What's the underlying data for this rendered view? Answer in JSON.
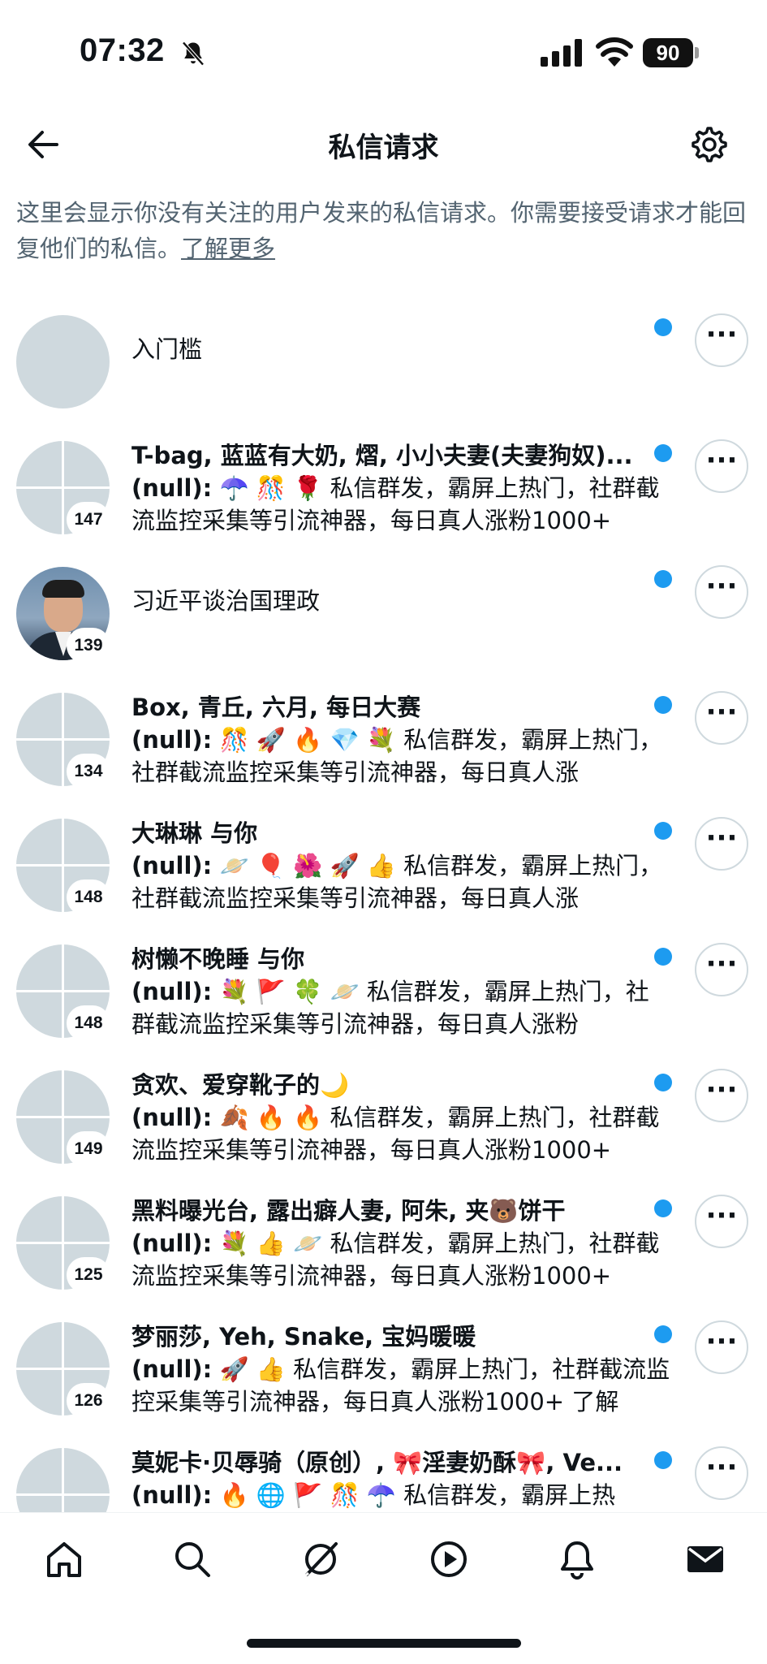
{
  "status_bar": {
    "time": "07:32",
    "battery": "90"
  },
  "header": {
    "title": "私信请求"
  },
  "description": {
    "text": "这里会显示你没有关注的用户发来的私信请求。你需要接受请求才能回复他们的私信。",
    "link": "了解更多"
  },
  "conversations": [
    {
      "name": "入门槛",
      "preview": "",
      "count": ""
    },
    {
      "name": "T-bag, 蓝蓝有大奶, 熠, 小小夫妻(夫妻狗奴)...",
      "preview": "☂️ 🎊 🌹 私信群发，霸屏上热门，社群截流监控采集等引流神器，每日真人涨粉1000+",
      "count": "147"
    },
    {
      "name": "习近平谈治国理政",
      "preview": "",
      "count": "139"
    },
    {
      "name": "Box, 青丘, 六月, 每日大赛",
      "preview": "🎊 🚀 🔥 💎 💐 私信群发，霸屏上热门，社群截流监控采集等引流神器，每日真人涨",
      "count": "134"
    },
    {
      "name": "大琳琳 与你",
      "preview": "🪐 🎈 🌺 🚀 👍 私信群发，霸屏上热门，社群截流监控采集等引流神器，每日真人涨",
      "count": "148"
    },
    {
      "name": "树懒不晚睡 与你",
      "preview": "💐 🚩 🍀 🪐 私信群发，霸屏上热门，社群截流监控采集等引流神器，每日真人涨粉",
      "count": "148"
    },
    {
      "name": "贪欢、爱穿靴子的🌙",
      "preview": "🍂 🔥 🔥 私信群发，霸屏上热门，社群截流监控采集等引流神器，每日真人涨粉1000+",
      "count": "149"
    },
    {
      "name": "黑料曝光台, 露出癖人妻, 阿朱, 夹🐻饼干",
      "preview": "💐 👍 🪐 私信群发，霸屏上热门，社群截流监控采集等引流神器，每日真人涨粉1000+",
      "count": "125"
    },
    {
      "name": "梦丽莎, Yeh, Snake, 宝妈暖暖",
      "preview": "🚀 👍 私信群发，霸屏上热门，社群截流监控采集等引流神器，每日真人涨粉1000+ 了解",
      "count": "126"
    },
    {
      "name": "莫妮卡·贝辱骑（原创）, 🎀淫妻奶酥🎀, Ve...",
      "preview": "🔥 🌐 🚩 🎊 ☂️ 私信群发，霸屏上热",
      "count": ""
    }
  ],
  "null_label": "(null):",
  "more_label": "···",
  "nav": [
    "home-icon",
    "search-icon",
    "grok-icon",
    "video-icon",
    "notifications-icon",
    "messages-icon"
  ],
  "colors": {
    "accent": "#1d9bf0",
    "avatar_placeholder": "#cfd9de",
    "secondary_text": "#536471"
  }
}
